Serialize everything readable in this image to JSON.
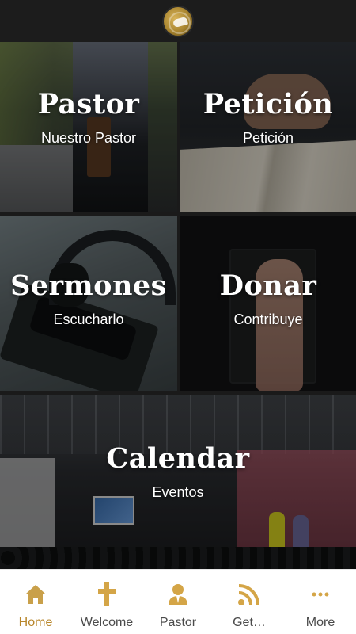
{
  "colors": {
    "accent": "#d4a547",
    "active_label": "#b8862b",
    "tab_label": "#4a4a4a",
    "topbar": "#1c1c1c"
  },
  "header": {
    "logo_icon": "church-logo-icon"
  },
  "tiles": {
    "pastor": {
      "title": "Pastor",
      "subtitle": "Nuestro Pastor"
    },
    "peticion": {
      "title": "Petición",
      "subtitle": "Petición"
    },
    "sermones": {
      "title": "Sermones",
      "subtitle": "Escucharlo"
    },
    "donar": {
      "title": "Donar",
      "subtitle": "Contribuye"
    },
    "calendar": {
      "title": "Calendar",
      "subtitle": "Eventos"
    }
  },
  "tabs": [
    {
      "label": "Home",
      "icon": "home-icon",
      "active": true
    },
    {
      "label": "Welcome",
      "icon": "cross-icon",
      "active": false
    },
    {
      "label": "Pastor",
      "icon": "person-icon",
      "active": false
    },
    {
      "label": "Get…",
      "icon": "rss-feed-icon",
      "active": false
    },
    {
      "label": "More",
      "icon": "more-dots-icon",
      "active": false
    }
  ]
}
